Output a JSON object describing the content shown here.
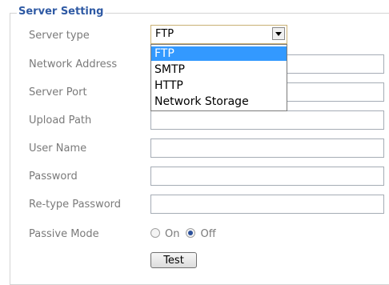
{
  "section": {
    "title": "Server Setting"
  },
  "fields": {
    "server_type": {
      "label": "Server type",
      "value": "FTP"
    },
    "network_address": {
      "label": "Network Address",
      "value": ""
    },
    "server_port": {
      "label": "Server Port",
      "value": ""
    },
    "upload_path": {
      "label": "Upload Path",
      "value": ""
    },
    "user_name": {
      "label": "User Name",
      "value": ""
    },
    "password": {
      "label": "Password",
      "value": ""
    },
    "retype_password": {
      "label": "Re-type Password",
      "value": ""
    },
    "passive_mode": {
      "label": "Passive Mode",
      "on_label": "On",
      "off_label": "Off",
      "selected": "Off"
    }
  },
  "dropdown": {
    "options": [
      "FTP",
      "SMTP",
      "HTTP",
      "Network Storage"
    ],
    "highlighted": "FTP"
  },
  "buttons": {
    "test": "Test"
  },
  "icons": {
    "select_arrow": "chevron-down-icon"
  },
  "colors": {
    "legend": "#2f5aa4",
    "label": "#7a7a7a",
    "highlight": "#3399ff",
    "radio_dot": "#2a4f9a"
  }
}
